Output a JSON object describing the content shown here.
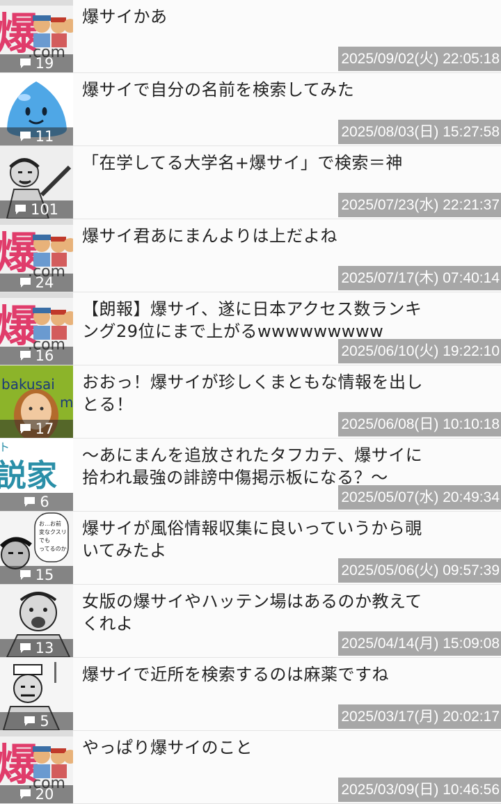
{
  "threads": [
    {
      "title": "爆サイかあ",
      "count": "19",
      "date": "2025/09/02(火) 22:05:18",
      "thumb": "bakusai-logo"
    },
    {
      "title": "爆サイで自分の名前を検索してみた",
      "count": "11",
      "date": "2025/08/03(日) 15:27:58",
      "thumb": "slime"
    },
    {
      "title": "「在学してる大学名+爆サイ」で検索＝神",
      "count": "101",
      "date": "2025/07/23(水) 22:21:37",
      "thumb": "manga-man"
    },
    {
      "title": "爆サイ君あにまんよりは上だよね",
      "count": "24",
      "date": "2025/07/17(木) 07:40:14",
      "thumb": "bakusai-logo"
    },
    {
      "title": "【朗報】爆サイ、遂に日本アクセス数ランキング29位にまで上がるwwwwwwwww",
      "count": "16",
      "date": "2025/06/10(火) 19:22:10",
      "thumb": "bakusai-logo"
    },
    {
      "title": "おおっ！爆サイが珍しくまともな情報を出しとる！",
      "count": "17",
      "date": "2025/06/08(日) 10:10:18",
      "thumb": "avatar-green"
    },
    {
      "title": "〜あにまんを追放されたタフカテ、爆サイに拾われ最強の誹謗中傷掲示板になる？〜",
      "count": "6",
      "date": "2025/05/07(水) 20:49:34",
      "thumb": "novel-cover"
    },
    {
      "title": "爆サイが風俗情報収集に良いっていうから覗いてみたよ",
      "count": "15",
      "date": "2025/05/06(火) 09:57:39",
      "thumb": "manga-quote"
    },
    {
      "title": "女版の爆サイやハッテン場はあるのか教えてくれよ",
      "count": "13",
      "date": "2025/04/14(月) 15:09:08",
      "thumb": "manga-shout"
    },
    {
      "title": "爆サイで近所を検索するのは麻薬ですね",
      "count": "5",
      "date": "2025/03/17(月) 20:02:17",
      "thumb": "manga-chef"
    },
    {
      "title": "やっぱり爆サイのこと",
      "count": "20",
      "date": "2025/03/09(日) 10:46:56",
      "thumb": "bakusai-logo"
    }
  ],
  "thumb_text": {
    "logo_text": "爆",
    "avatar_text_top": "bakusai",
    "avatar_text_bottom": "m",
    "novel_text": "説家",
    "novel_corner": "ト",
    "quote_text": "お…お前 変なクスリでも やってるのか"
  },
  "icons": {
    "comment": "comment-bubble-icon"
  },
  "colors": {
    "date_bg": "#a7a7a7",
    "count_bg": "#555555",
    "logo_red": "#e03c6b"
  }
}
